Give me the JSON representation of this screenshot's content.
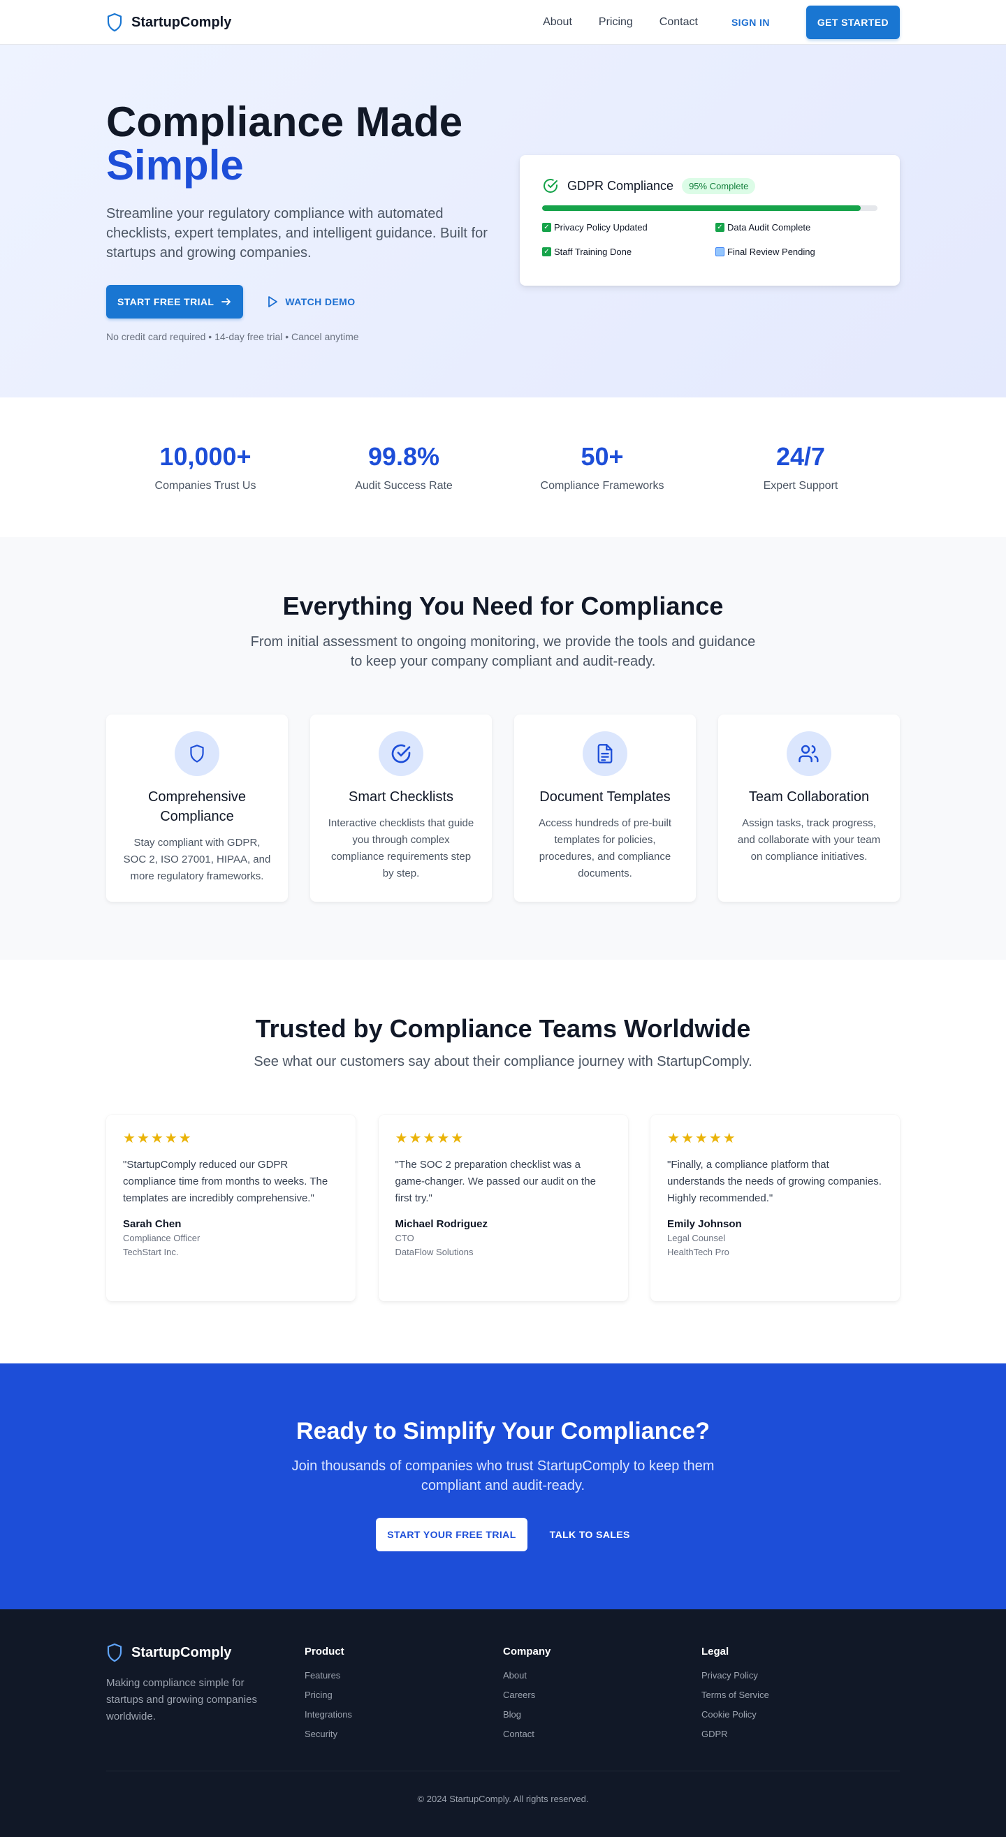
{
  "nav": {
    "brand": "StartupComply",
    "links": [
      "About",
      "Pricing",
      "Contact"
    ],
    "sign_in": "SIGN IN",
    "get_started": "GET STARTED"
  },
  "hero": {
    "title_line1": "Compliance Made",
    "title_line2": "Simple",
    "subtitle": "Streamline your regulatory compliance with automated checklists, expert templates, and intelligent guidance. Built for startups and growing companies.",
    "primary_cta": "START FREE TRIAL",
    "secondary_cta": "WATCH DEMO",
    "note": "No credit card required • 14-day free trial • Cancel anytime",
    "card": {
      "title": "GDPR Compliance",
      "badge": "95% Complete",
      "progress": 0.95,
      "items": [
        {
          "label": "Privacy Policy Updated",
          "status": "done"
        },
        {
          "label": "Data Audit Complete",
          "status": "done"
        },
        {
          "label": "Staff Training Done",
          "status": "done"
        },
        {
          "label": "Final Review Pending",
          "status": "pending"
        }
      ]
    }
  },
  "stats": [
    {
      "value": "10,000+",
      "label": "Companies Trust Us"
    },
    {
      "value": "99.8%",
      "label": "Audit Success Rate"
    },
    {
      "value": "50+",
      "label": "Compliance Frameworks"
    },
    {
      "value": "24/7",
      "label": "Expert Support"
    }
  ],
  "features": {
    "title": "Everything You Need for Compliance",
    "subtitle": "From initial assessment to ongoing monitoring, we provide the tools and guidance to keep your company compliant and audit-ready.",
    "cards": [
      {
        "icon": "shield-icon",
        "title": "Comprehensive Compliance",
        "desc": "Stay compliant with GDPR, SOC 2, ISO 27001, HIPAA, and more regulatory frameworks."
      },
      {
        "icon": "check-circle-icon",
        "title": "Smart Checklists",
        "desc": "Interactive checklists that guide you through complex compliance requirements step by step."
      },
      {
        "icon": "document-icon",
        "title": "Document Templates",
        "desc": "Access hundreds of pre-built templates for policies, procedures, and compliance documents."
      },
      {
        "icon": "team-icon",
        "title": "Team Collaboration",
        "desc": "Assign tasks, track progress, and collaborate with your team on compliance initiatives."
      }
    ]
  },
  "testimonials": {
    "title": "Trusted by Compliance Teams Worldwide",
    "subtitle": "See what our customers say about their compliance journey with StartupComply.",
    "items": [
      {
        "rating": 5,
        "quote": "\"StartupComply reduced our GDPR compliance time from months to weeks. The templates are incredibly comprehensive.\"",
        "name": "Sarah Chen",
        "role": "Compliance Officer",
        "company": "TechStart Inc."
      },
      {
        "rating": 5,
        "quote": "\"The SOC 2 preparation checklist was a game-changer. We passed our audit on the first try.\"",
        "name": "Michael Rodriguez",
        "role": "CTO",
        "company": "DataFlow Solutions"
      },
      {
        "rating": 5,
        "quote": "\"Finally, a compliance platform that understands the needs of growing companies. Highly recommended.\"",
        "name": "Emily Johnson",
        "role": "Legal Counsel",
        "company": "HealthTech Pro"
      }
    ]
  },
  "cta": {
    "title": "Ready to Simplify Your Compliance?",
    "subtitle": "Join thousands of companies who trust StartupComply to keep them compliant and audit-ready.",
    "primary": "START YOUR FREE TRIAL",
    "secondary": "TALK TO SALES"
  },
  "footer": {
    "brand": "StartupComply",
    "tagline": "Making compliance simple for startups and growing companies worldwide.",
    "columns": [
      {
        "heading": "Product",
        "links": [
          "Features",
          "Pricing",
          "Integrations",
          "Security"
        ]
      },
      {
        "heading": "Company",
        "links": [
          "About",
          "Careers",
          "Blog",
          "Contact"
        ]
      },
      {
        "heading": "Legal",
        "links": [
          "Privacy Policy",
          "Terms of Service",
          "Cookie Policy",
          "GDPR"
        ]
      }
    ],
    "copyright": "© 2024 StartupComply. All rights reserved."
  },
  "colors": {
    "primary": "#1976d2",
    "accent": "#1d4ed8",
    "success": "#16a34a",
    "star": "#eab308",
    "footer_bg": "#111827"
  }
}
